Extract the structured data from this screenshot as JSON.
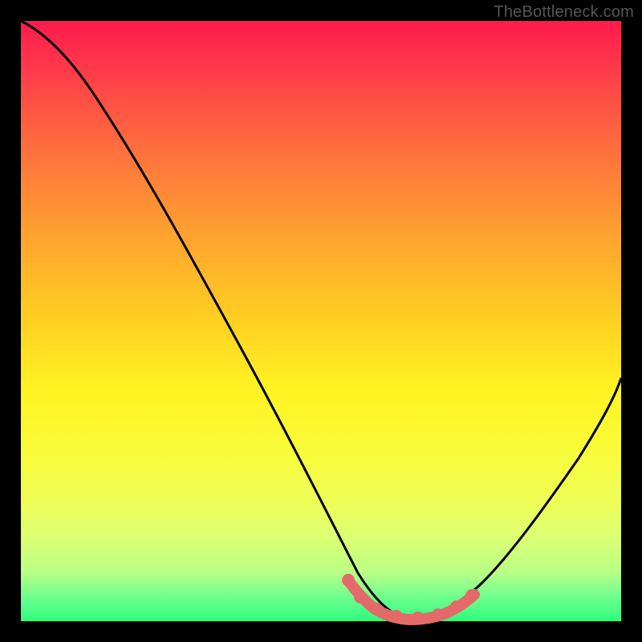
{
  "watermark": "TheBottleneck.com",
  "colors": {
    "background": "#000000",
    "gradient_top": "#ff1a4d",
    "gradient_mid": "#fff423",
    "gradient_bottom": "#2dfc7e",
    "curve": "#000000",
    "marker": "#e46a6a"
  },
  "chart_data": {
    "type": "line",
    "title": "",
    "xlabel": "",
    "ylabel": "",
    "xlim": [
      0,
      100
    ],
    "ylim": [
      0,
      100
    ],
    "x": [
      0,
      4,
      8,
      12,
      16,
      20,
      24,
      28,
      32,
      36,
      40,
      44,
      48,
      52,
      54,
      56,
      58,
      60,
      62,
      64,
      66,
      68,
      72,
      76,
      80,
      84,
      88,
      92,
      96,
      100
    ],
    "values": [
      100,
      98,
      94,
      88,
      82,
      75,
      68,
      61,
      54,
      47,
      40,
      33,
      26,
      18,
      14,
      10,
      6,
      3,
      1,
      0,
      0,
      0,
      1,
      4,
      8,
      14,
      21,
      29,
      38,
      48
    ],
    "annotations": {
      "marker_region_x": [
        52,
        68
      ],
      "marker_points_x": [
        53,
        55,
        57,
        59,
        61,
        63,
        65,
        67
      ]
    }
  }
}
